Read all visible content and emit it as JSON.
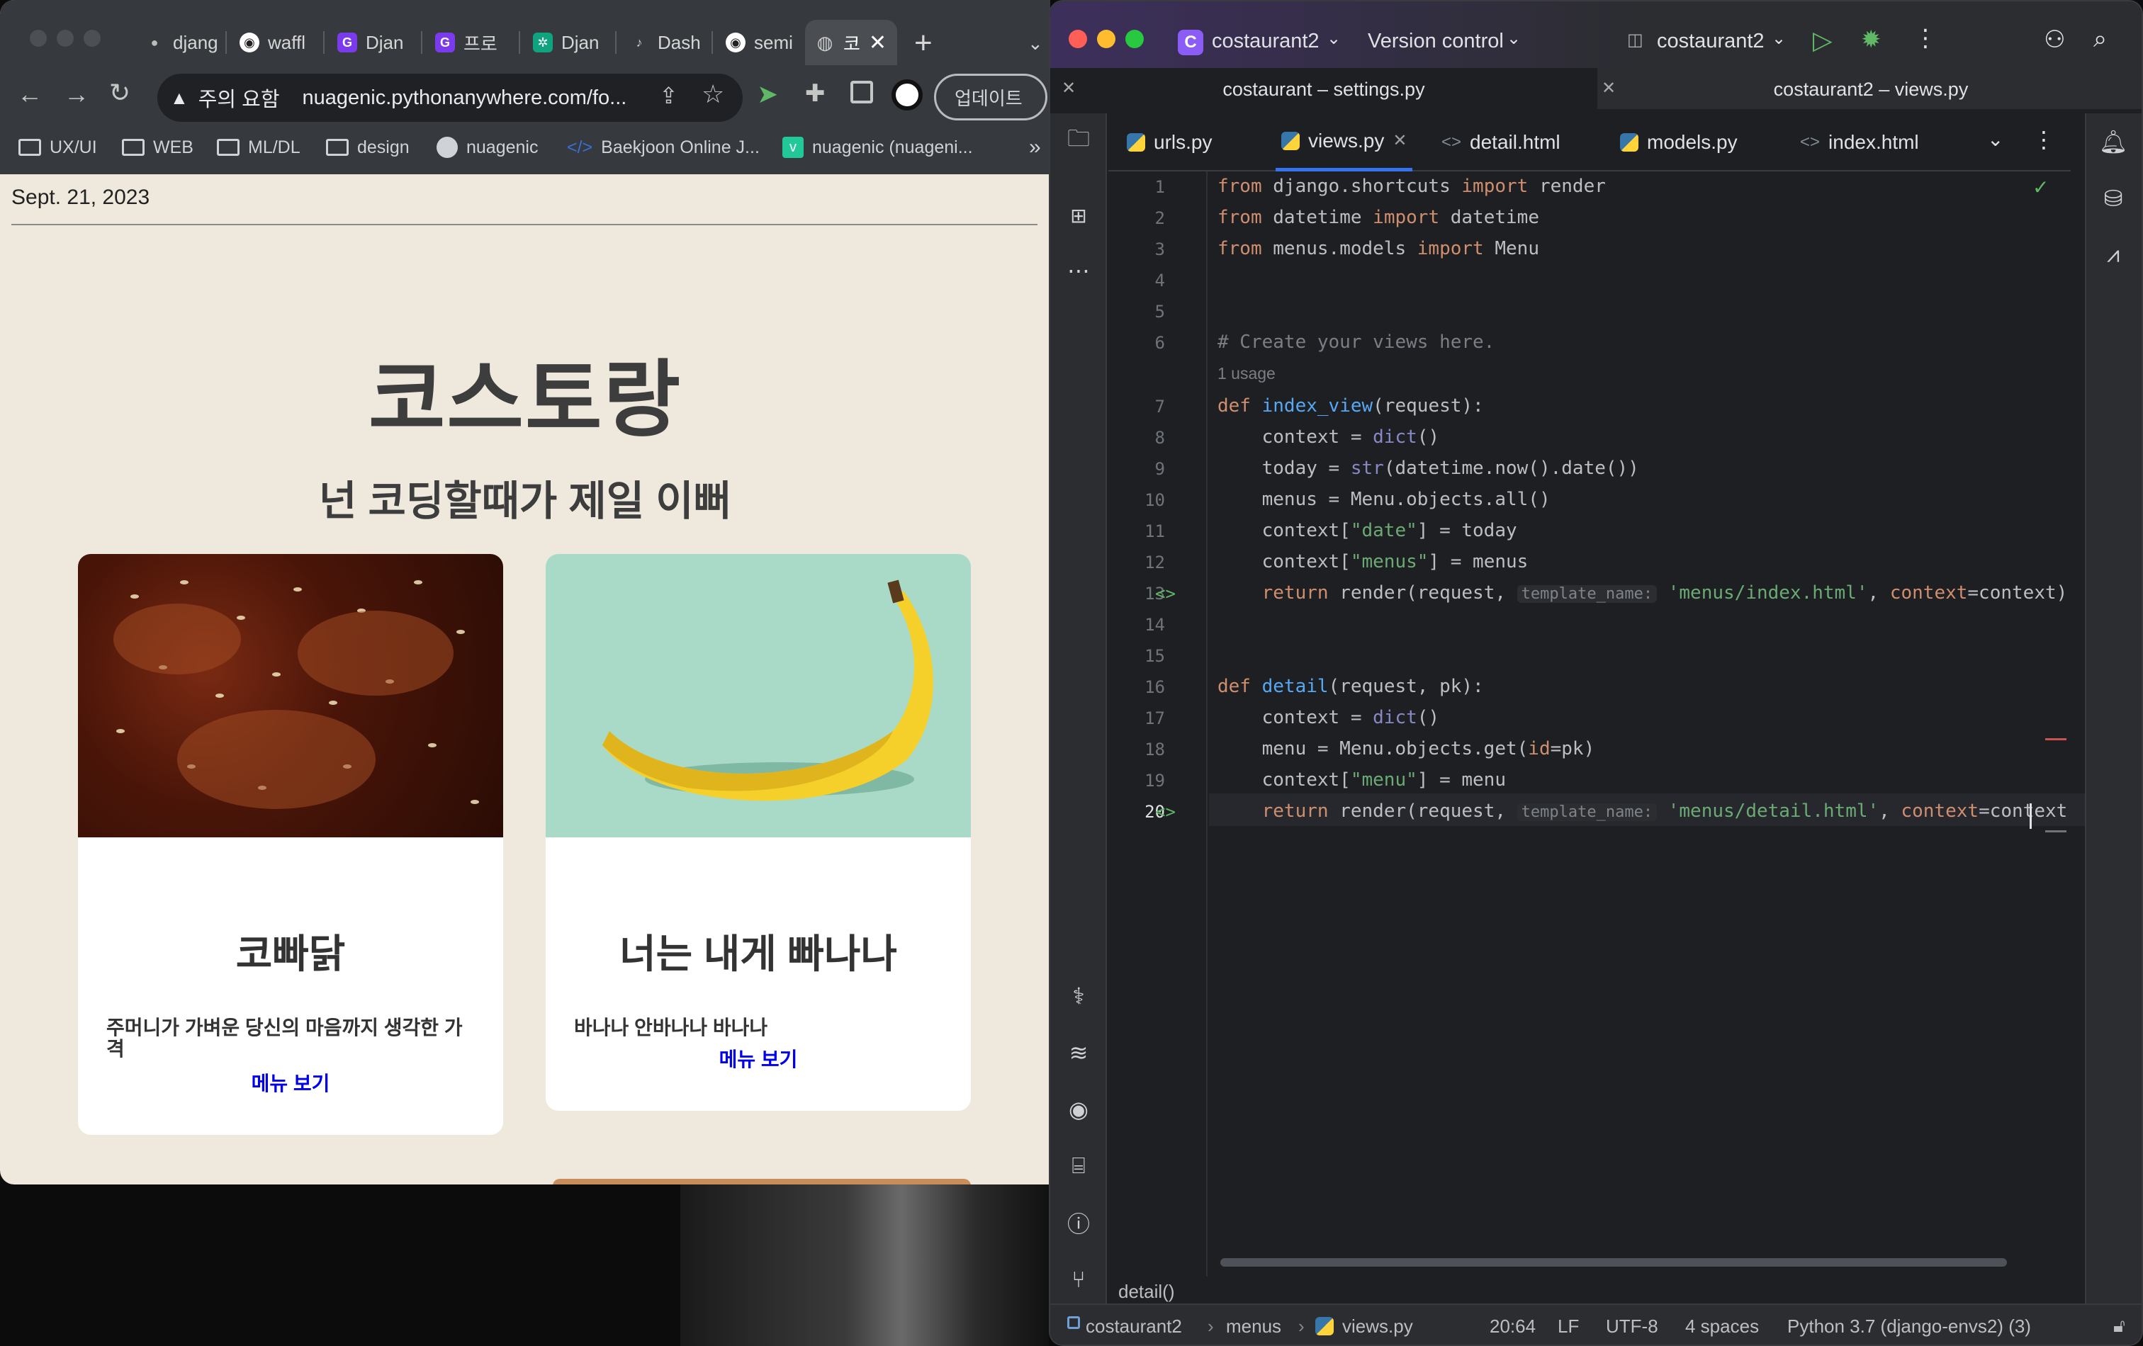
{
  "browser": {
    "tabs": [
      {
        "label": "djang",
        "icon": "apple-icon"
      },
      {
        "label": "waffl",
        "icon": "github-icon"
      },
      {
        "label": "Djan",
        "icon": "django-icon"
      },
      {
        "label": "프로",
        "icon": "django-icon"
      },
      {
        "label": "Djan",
        "icon": "openai-icon"
      },
      {
        "label": "Dash",
        "icon": "guitar-icon"
      },
      {
        "label": "semi",
        "icon": "github-icon"
      },
      {
        "label": "코",
        "icon": "globe-icon"
      }
    ],
    "new_tab": "+",
    "security_label": "주의 요함",
    "url": "nuagenic.pythonanywhere.com/fo...",
    "update_label": "업데이트",
    "bookmarks": [
      {
        "label": "UX/UI",
        "icon": "folder-icon"
      },
      {
        "label": "WEB",
        "icon": "folder-icon"
      },
      {
        "label": "ML/DL",
        "icon": "folder-icon"
      },
      {
        "label": "design",
        "icon": "folder-icon"
      },
      {
        "label": "nuagenic",
        "icon": "github-icon"
      },
      {
        "label": "Baekjoon Online J...",
        "icon": "code-icon"
      },
      {
        "label": "nuagenic (nuageni...",
        "icon": "velog-icon"
      }
    ],
    "bookmarks_more": "»",
    "page": {
      "date": "Sept. 21, 2023",
      "title": "코스토랑",
      "subtitle": "넌 코딩할때가 제일 이뻐",
      "cards": [
        {
          "title": "코빠닭",
          "description": "주머니가 가벼운 당신의 마음까지 생각한 가격",
          "link": "메뉴 보기"
        },
        {
          "title": "너는 내게 빠나나",
          "description": "바나나 안바나나 바나나",
          "link": "메뉴 보기"
        }
      ]
    }
  },
  "ide": {
    "project_badge": "C",
    "project_name": "costaurant2",
    "vcs_label": "Version control",
    "run_config": "costaurant2",
    "window_tabs": [
      "costaurant – settings.py",
      "costaurant2 – views.py"
    ],
    "file_tabs": [
      {
        "label": "urls.py",
        "type": "python"
      },
      {
        "label": "views.py",
        "type": "python",
        "active": true
      },
      {
        "label": "detail.html",
        "type": "html"
      },
      {
        "label": "models.py",
        "type": "python"
      },
      {
        "label": "index.html",
        "type": "html"
      }
    ],
    "line_numbers": [
      "1",
      "2",
      "3",
      "4",
      "5",
      "6",
      "7",
      "8",
      "9",
      "10",
      "11",
      "12",
      "13",
      "14",
      "15",
      "16",
      "17",
      "18",
      "19",
      "20"
    ],
    "usage_hint": "1 usage",
    "code": {
      "l1": [
        "from",
        " django.shortcuts ",
        "import",
        " render"
      ],
      "l2": [
        "from",
        " datetime ",
        "import",
        " datetime"
      ],
      "l3": [
        "from",
        " menus.models ",
        "import",
        " Menu"
      ],
      "l6": "# Create your views here.",
      "l7": [
        "def",
        " ",
        "index_view",
        "(request):"
      ],
      "l8": [
        "    context = ",
        "dict",
        "()"
      ],
      "l9": [
        "    today = ",
        "str",
        "(datetime.now().date())"
      ],
      "l10": "    menus = Menu.objects.all()",
      "l11": [
        "    context[",
        "\"date\"",
        "] = today"
      ],
      "l12": [
        "    context[",
        "\"menus\"",
        "] = menus"
      ],
      "l13": [
        "    ",
        "return",
        " render(request, ",
        "template_name:",
        " ",
        "'menus/index.html'",
        ", ",
        "context",
        "=context)"
      ],
      "l16": [
        "def",
        " ",
        "detail",
        "(request, pk):"
      ],
      "l17": [
        "    context = ",
        "dict",
        "()"
      ],
      "l18": [
        "    menu = Menu.objects.get(",
        "id",
        "=pk)"
      ],
      "l19": [
        "    context[",
        "\"menu\"",
        "] = menu"
      ],
      "l20": [
        "    ",
        "return",
        " render(request, ",
        "template_name:",
        " ",
        "'menus/detail.html'",
        ", ",
        "context",
        "=context"
      ]
    },
    "breadcrumb_function": "detail()",
    "status": {
      "project": "costaurant2",
      "folder": "menus",
      "file": "views.py",
      "position": "20:64",
      "line_sep": "LF",
      "encoding": "UTF-8",
      "indent": "4 spaces",
      "interpreter": "Python 3.7 (django-envs2) (3)"
    }
  }
}
